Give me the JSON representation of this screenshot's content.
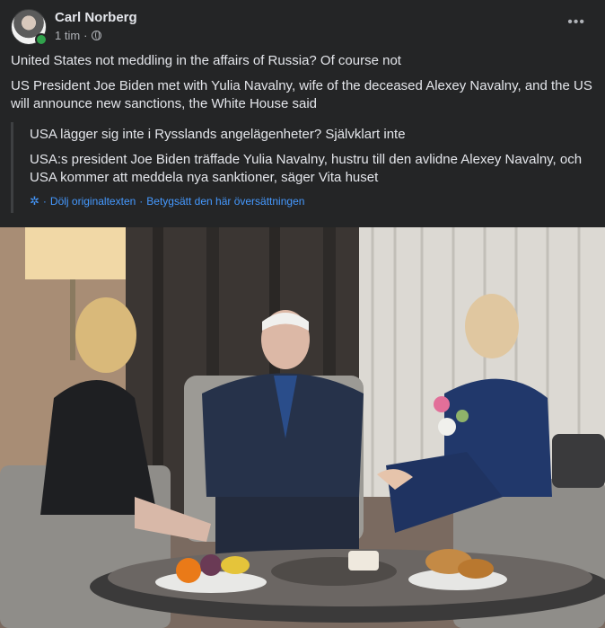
{
  "post": {
    "author": "Carl Norberg",
    "time": "1 tim",
    "separator": "·",
    "more_icon": "ellipsis-icon",
    "privacy_icon": "globe-icon",
    "text_lines": [
      "United States not meddling in the affairs of Russia? Of course not",
      "US President Joe Biden met with Yulia Navalny, wife of the deceased Alexey Navalny, and the US will announce new sanctions, the White House said"
    ]
  },
  "translation": {
    "lines": [
      "USA lägger sig inte i Rysslands angelägenheter? Självklart inte",
      "USA:s president Joe Biden träffade Yulia Navalny, hustru till den avlidne Alexey Navalny, och USA kommer att meddela nya sanktioner, säger Vita huset"
    ],
    "hide_original_label": "Dölj originaltexten",
    "rate_translation_label": "Betygsätt den här översättningen",
    "separator": "·",
    "icon": "gear-icon"
  },
  "colors": {
    "background": "#242526",
    "text": "#e4e6eb",
    "secondary_text": "#b0b3b8",
    "link": "#4599ff",
    "online": "#31a24c"
  }
}
